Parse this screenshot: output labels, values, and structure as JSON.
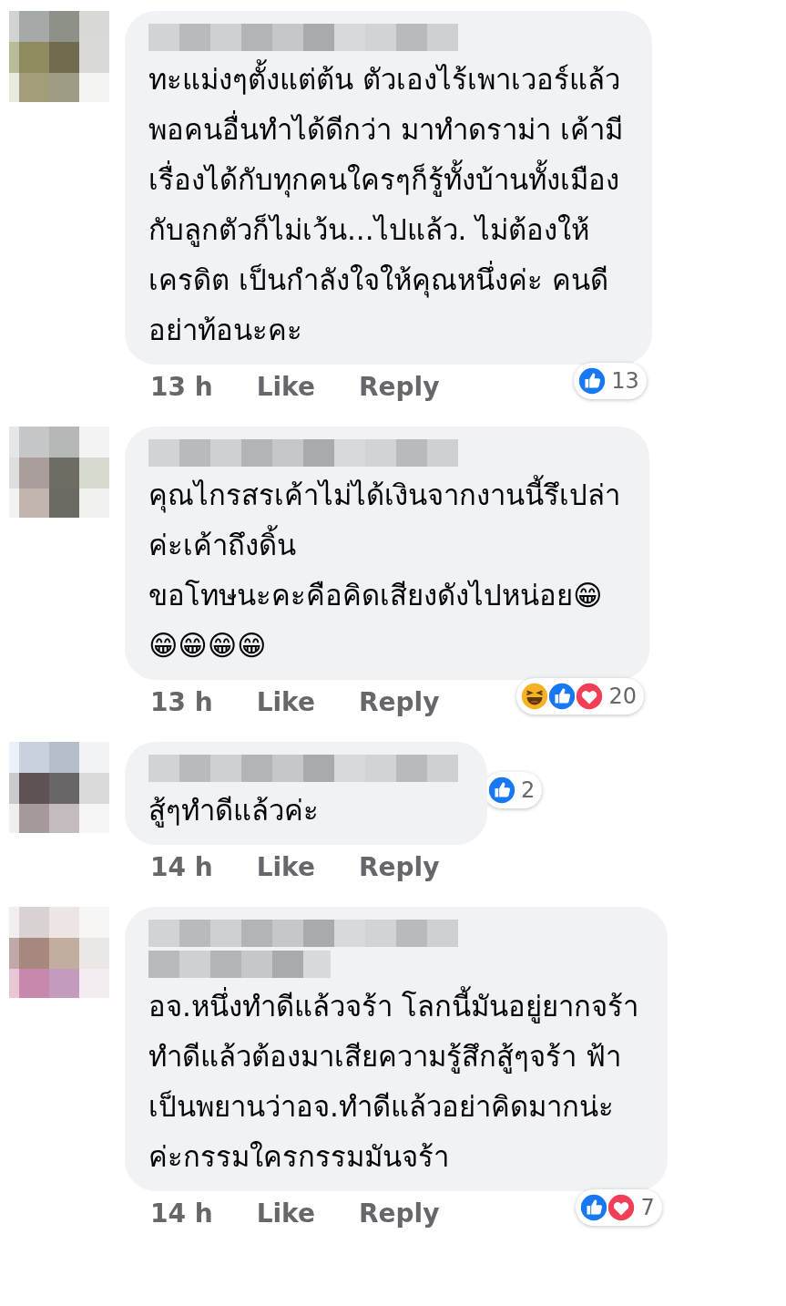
{
  "comments": [
    {
      "avatar": {
        "kind": "picture"
      },
      "author_lines": [
        {
          "kind": "redacted"
        }
      ],
      "text": "ทะแม่งๆตั้งแต่ต้น ตัวเองไร้เพาเวอร์แล้ว\nพอคนอื่นทำได้ดีกว่า มาทำดราม่า เค้ามี\nเรื่องได้กับทุกคนใครๆก็รู้ทั้งบ้านทั้งเมือง\nกับลูกตัวก็ไม่เว้น...ไปแล้ว. ไม่ต้องให้\nเครดิต เป็นกำลังใจให้คุณหนึ่งค่ะ คนดี\nอย่าท้อนะคะ",
      "time": "13 h",
      "like": "Like",
      "reply": "Reply",
      "reactions": {
        "kind": "corner",
        "icons": [
          {
            "kind": "like"
          }
        ],
        "count": "13"
      }
    },
    {
      "avatar": {
        "kind": "picture"
      },
      "author_lines": [
        {
          "kind": "redacted"
        }
      ],
      "text": "คุณไกรสรเค้าไม่ได้เงินจากงานนี้รึเปล่า\nค่ะเค้าถึงดิ้น\nขอโทษนะคะคือคิดเสียงดังไปหน่อย😁\n😁😁😁😁",
      "time": "13 h",
      "like": "Like",
      "reply": "Reply",
      "reactions": {
        "kind": "corner",
        "icons": [
          {
            "kind": "haha"
          },
          {
            "kind": "like"
          },
          {
            "kind": "love"
          }
        ],
        "count": "20"
      }
    },
    {
      "avatar": {
        "kind": "picture"
      },
      "author_lines": [
        {
          "kind": "redacted"
        }
      ],
      "text": "สู้ๆทำดีแล้วค่ะ",
      "time": "14 h",
      "like": "Like",
      "reply": "Reply",
      "reactions": {
        "kind": "beside",
        "icons": [
          {
            "kind": "like"
          }
        ],
        "count": "2"
      }
    },
    {
      "avatar": {
        "kind": "picture"
      },
      "author_lines": [
        {
          "kind": "redacted"
        },
        {
          "kind": "redacted"
        }
      ],
      "text": "อจ.หนึ่งทำดีแล้วจร้า โลกนี้มันอยู่ยากจร้า\nทำดีแล้วต้องมาเสียความรู้สึกสู้ๆจร้า ฟ้า\nเป็นพยานว่าอจ.ทำดีแล้วอย่าคิดมากน่ะ\nค่ะกรรมใครกรรมมันจร้า",
      "time": "14 h",
      "like": "Like",
      "reply": "Reply",
      "reactions": {
        "kind": "corner",
        "icons": [
          {
            "kind": "like"
          },
          {
            "kind": "love"
          }
        ],
        "count": "7"
      }
    }
  ]
}
